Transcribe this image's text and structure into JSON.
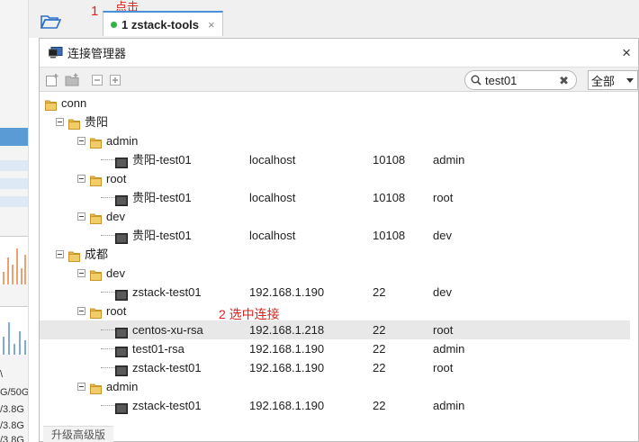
{
  "background_app": {
    "disk_labels": [
      "\\",
      "G/50G",
      "/3.8G",
      "/3.8G",
      "/3.8G"
    ]
  },
  "tabbar": {
    "step1_number": "1",
    "step1_hint": "点击",
    "tab_label": "1 zstack-tools",
    "tab_close": "×"
  },
  "dialog": {
    "title": "连接管理器",
    "close": "×",
    "search_value": "test01",
    "filter_selected": "全部",
    "upgrade_label": "升级高级版",
    "annotation_step2": "2  选中连接"
  },
  "tree": [
    {
      "kind": "group",
      "label": "conn",
      "level": 0
    },
    {
      "kind": "group",
      "label": "贵阳",
      "level": 1
    },
    {
      "kind": "group",
      "label": "admin",
      "level": 2
    },
    {
      "kind": "conn",
      "label": "贵阳-test01",
      "host": "localhost",
      "port": "10108",
      "user": "admin",
      "level": 3
    },
    {
      "kind": "group",
      "label": "root",
      "level": 2
    },
    {
      "kind": "conn",
      "label": "贵阳-test01",
      "host": "localhost",
      "port": "10108",
      "user": "root",
      "level": 3
    },
    {
      "kind": "group",
      "label": "dev",
      "level": 2
    },
    {
      "kind": "conn",
      "label": "贵阳-test01",
      "host": "localhost",
      "port": "10108",
      "user": "dev",
      "level": 3
    },
    {
      "kind": "group",
      "label": "成都",
      "level": 1
    },
    {
      "kind": "group",
      "label": "dev",
      "level": 2
    },
    {
      "kind": "conn",
      "label": "zstack-test01",
      "host": "192.168.1.190",
      "port": "22",
      "user": "dev",
      "level": 3
    },
    {
      "kind": "group",
      "label": "root",
      "level": 2
    },
    {
      "kind": "conn",
      "label": "centos-xu-rsa",
      "host": "192.168.1.218",
      "port": "22",
      "user": "root",
      "level": 3,
      "selected": true
    },
    {
      "kind": "conn",
      "label": "test01-rsa",
      "host": "192.168.1.190",
      "port": "22",
      "user": "admin",
      "level": 3
    },
    {
      "kind": "conn",
      "label": "zstack-test01",
      "host": "192.168.1.190",
      "port": "22",
      "user": "root",
      "level": 3
    },
    {
      "kind": "group",
      "label": "admin",
      "level": 2
    },
    {
      "kind": "conn",
      "label": "zstack-test01",
      "host": "192.168.1.190",
      "port": "22",
      "user": "admin",
      "level": 3
    }
  ],
  "colors": {
    "annotation": "#d9251d",
    "folder": "#e8b84a",
    "tab_active_accent": "#4a90d9",
    "status_dot": "#2fb344"
  }
}
